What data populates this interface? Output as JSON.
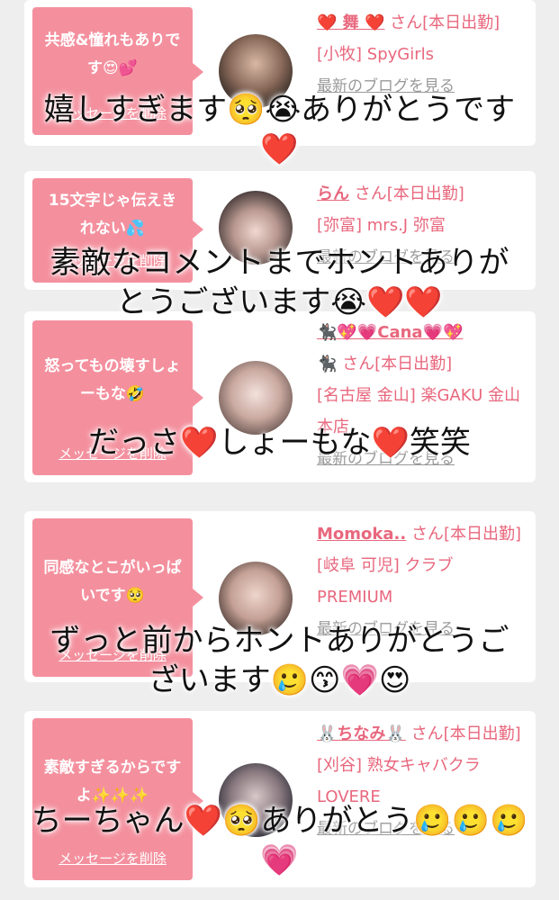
{
  "colors": {
    "accent": "#e8677d",
    "bubble": "#f4909e",
    "overlay_text": "#111111",
    "link_gray": "#999999"
  },
  "cards": [
    {
      "bubble_text": "共感&憧れもありです😍💕",
      "delete_label": "メッセージを削除",
      "name": "❤️ 舞 ❤️",
      "san": "さん",
      "status": "[本日出勤]",
      "shop": "[小牧] SpyGirls",
      "blog_link": "最新のブログを見る"
    },
    {
      "bubble_text": "15文字じゃ伝えきれない💦",
      "delete_label": "メッセージを削除",
      "name": "らん",
      "san": "さん",
      "status": "[本日出勤]",
      "shop": "[弥富] mrs.J 弥富",
      "blog_link": "最新のブログを見る"
    },
    {
      "bubble_text": "怒ってもの壊すしょーもな🤣",
      "delete_label": "メッセージを削除",
      "name": "🐈‍⬛💖💗Cana💗💖",
      "name2": "🐈‍⬛",
      "san": "さん",
      "status": "[本日出勤]",
      "shop": "[名古屋 金山] 楽GAKU 金山本店",
      "blog_link": "最新のブログを見る"
    },
    {
      "bubble_text": "同感なとこがいっぱいです🥺",
      "delete_label": "メッセージを削除",
      "name": "Momoka..",
      "san": "さん",
      "status": "[本日出勤]",
      "shop": "[岐阜 可児] クラブ PREMIUM",
      "blog_link": "最新のブログを見る"
    },
    {
      "bubble_text": "素敵すぎるからですよ✨✨✨",
      "delete_label": "メッセージを削除",
      "name": "🐰ちなみ🐰",
      "san": "さん",
      "status": "[本日出勤]",
      "shop": "[刈谷] 熟女キャバクラ LOVERE",
      "blog_link": "最新のブログを見る"
    }
  ],
  "overlays": [
    {
      "line1": "嬉しすぎます🥺😭ありがとうです",
      "line2": "❤️"
    },
    {
      "line1": "素敵なコメントまでホントありが",
      "line2": "とうございます😭❤️❤️"
    },
    {
      "line1": "だっさ❤️しょーもな❤️笑笑"
    },
    {
      "line1": "ずっと前からホントありがとうご",
      "line2": "ざいます🥲😙💗😍"
    },
    {
      "line1": "ちーちゃん❤️🥺ありがとう🥲🥲🥲",
      "line2": "💗"
    }
  ]
}
